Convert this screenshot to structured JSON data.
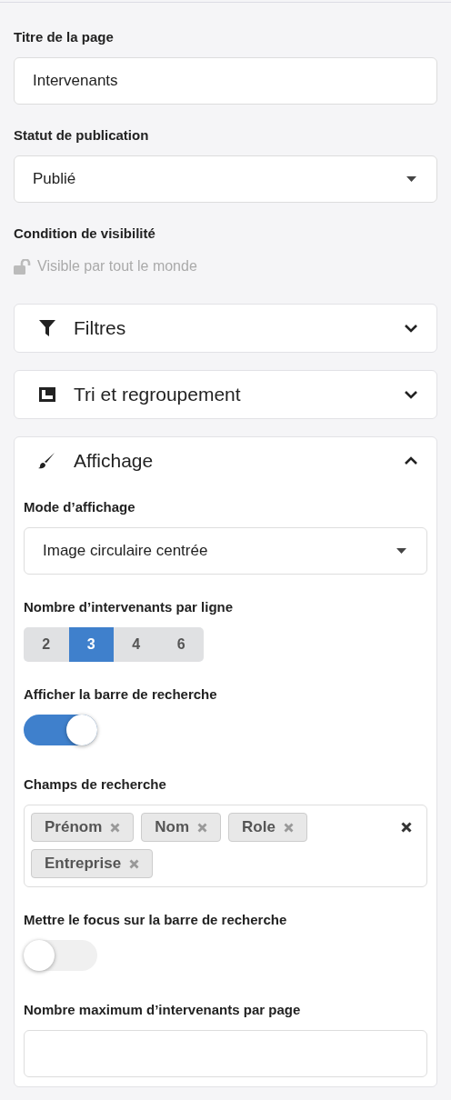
{
  "page_title": {
    "label": "Titre de la page",
    "value": "Intervenants"
  },
  "publication_status": {
    "label": "Statut de publication",
    "value": "Publié"
  },
  "visibility": {
    "label": "Condition de visibilité",
    "text": "Visible par tout le monde"
  },
  "sections": [
    {
      "title": "Filtres",
      "kind": "filter",
      "expanded": false
    },
    {
      "title": "Tri et regroupement",
      "kind": "sort",
      "expanded": false
    },
    {
      "title": "Affichage",
      "kind": "display",
      "expanded": true,
      "fields": [
        {
          "kind": "select",
          "label": "Mode d’affichage",
          "value": "Image circulaire centrée"
        },
        {
          "kind": "segmented",
          "label": "Nombre d’intervenants par ligne",
          "options": [
            {
              "label": "2",
              "selected": false
            },
            {
              "label": "3",
              "selected": true
            },
            {
              "label": "4",
              "selected": false
            },
            {
              "label": "6",
              "selected": false
            }
          ]
        },
        {
          "kind": "toggle",
          "label": "Afficher la barre de recherche",
          "on": true
        },
        {
          "kind": "tags",
          "label": "Champs de recherche",
          "tags": [
            "Prénom",
            "Nom",
            "Role",
            "Entreprise"
          ]
        },
        {
          "kind": "toggle",
          "label": "Mettre le focus sur la barre de recherche",
          "on": false
        },
        {
          "kind": "input",
          "label": "Nombre maximum d’intervenants par page"
        }
      ]
    }
  ]
}
